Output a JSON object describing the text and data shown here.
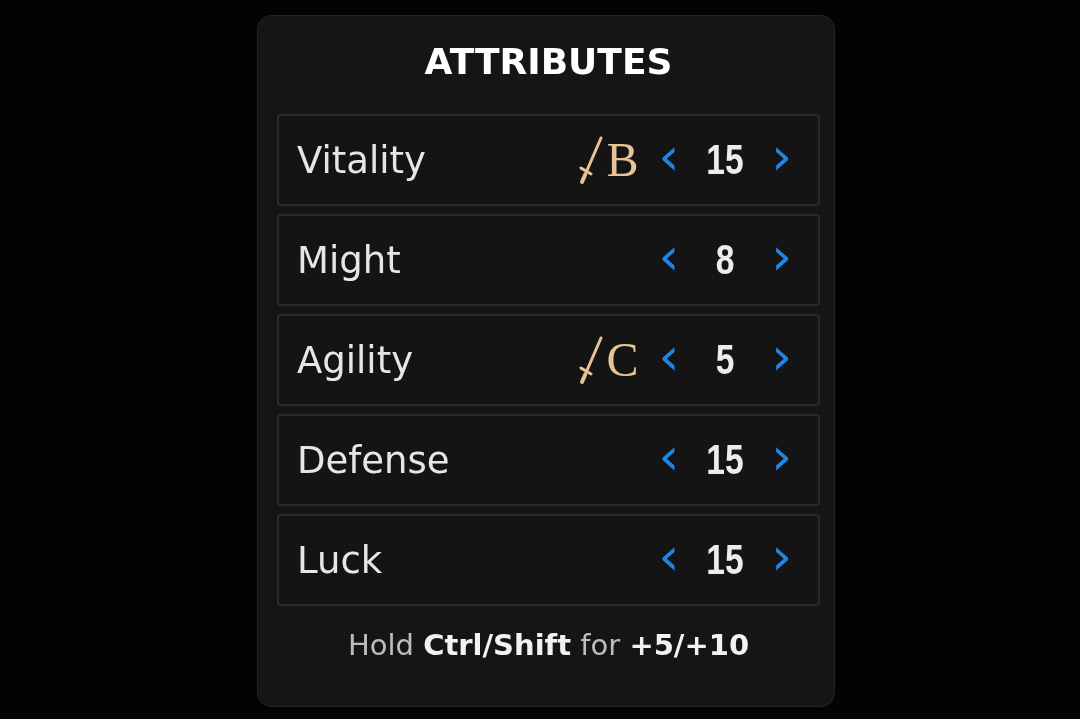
{
  "title": "ATTRIBUTES",
  "attributes": [
    {
      "name": "Vitality",
      "scaling": "B",
      "decrement": "‹",
      "value": "15",
      "increment": "›"
    },
    {
      "name": "Might",
      "decrement": "‹",
      "value": "8",
      "increment": "›"
    },
    {
      "name": "Agility",
      "scaling": "C",
      "decrement": "‹",
      "value": "5",
      "increment": "›"
    },
    {
      "name": "Defense",
      "decrement": "‹",
      "value": "15",
      "increment": "›"
    },
    {
      "name": "Luck",
      "decrement": "‹",
      "value": "15",
      "increment": "›"
    }
  ],
  "hint": "Hold **Ctrl/Shift** for **+5/+10**"
}
